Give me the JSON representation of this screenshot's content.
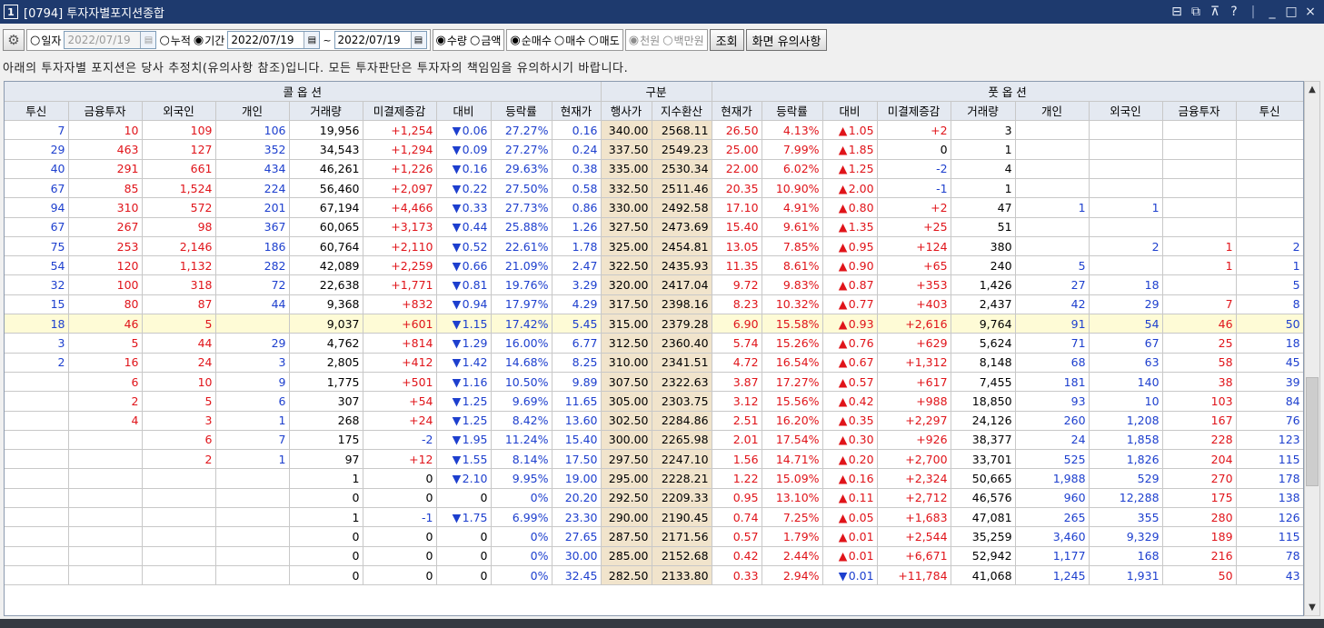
{
  "window": {
    "number": "1",
    "title": "[0794] 투자자별포지션종합",
    "controls": [
      "⊟",
      "⧉",
      "⊼",
      "?",
      "|",
      "_",
      "□",
      "×"
    ]
  },
  "toolbar": {
    "gear": "⚙",
    "date_mode": {
      "single_label": "일자",
      "single_date": "2022/07/19",
      "cumulative_label": "누적",
      "period_label": "기간",
      "from_date": "2022/07/19",
      "tilde": "~",
      "to_date": "2022/07/19",
      "selected": "기간"
    },
    "unit_mode": {
      "qty_label": "수량",
      "amount_label": "금액",
      "selected": "수량"
    },
    "trade_mode": {
      "net_label": "순매수",
      "buy_label": "매수",
      "sell_label": "매도",
      "selected": "순매수"
    },
    "currency_mode": {
      "won_label": "천원",
      "million_label": "백만원",
      "selected": "천원"
    },
    "query_button": "조회",
    "notes_button": "화면 유의사항",
    "radio_on": "◉",
    "radio_off": "○",
    "cal_icon": "▤"
  },
  "notice": "아래의 투자자별 포지션은 당사 추정치(유의사항 참조)입니다. 모든 투자판단은 투자자의 책임임을 유의하시기 바랍니다.",
  "grid": {
    "group_headers": {
      "call": "콜 옵 션",
      "center": "구분",
      "put": "풋 옵 션"
    },
    "headers": [
      "투신",
      "금융투자",
      "외국인",
      "개인",
      "거래량",
      "미결제증감",
      "대비",
      "등락률",
      "현재가",
      "행사가",
      "지수환산",
      "현재가",
      "등락률",
      "대비",
      "미결제증감",
      "거래량",
      "개인",
      "외국인",
      "금융투자",
      "투신"
    ],
    "highlight_row": 10,
    "rows": [
      [
        "7",
        "10",
        "109",
        "106",
        "19,956",
        "+1,254",
        "dn",
        "0.06",
        "27.27%",
        "0.16",
        "340.00",
        "2568.11",
        "26.50",
        "4.13%",
        "up",
        "1.05",
        "+2",
        "3",
        "",
        "",
        "",
        ""
      ],
      [
        "29",
        "463",
        "127",
        "352",
        "34,543",
        "+1,294",
        "dn",
        "0.09",
        "27.27%",
        "0.24",
        "337.50",
        "2549.23",
        "25.00",
        "7.99%",
        "up",
        "1.85",
        "0",
        "1",
        "",
        "",
        "",
        ""
      ],
      [
        "40",
        "291",
        "661",
        "434",
        "46,261",
        "+1,226",
        "dn",
        "0.16",
        "29.63%",
        "0.38",
        "335.00",
        "2530.34",
        "22.00",
        "6.02%",
        "up",
        "1.25",
        "-2",
        "4",
        "",
        "",
        "",
        ""
      ],
      [
        "67",
        "85",
        "1,524",
        "224",
        "56,460",
        "+2,097",
        "dn",
        "0.22",
        "27.50%",
        "0.58",
        "332.50",
        "2511.46",
        "20.35",
        "10.90%",
        "up",
        "2.00",
        "-1",
        "1",
        "",
        "",
        "",
        ""
      ],
      [
        "94",
        "310",
        "572",
        "201",
        "67,194",
        "+4,466",
        "dn",
        "0.33",
        "27.73%",
        "0.86",
        "330.00",
        "2492.58",
        "17.10",
        "4.91%",
        "up",
        "0.80",
        "+2",
        "47",
        "1",
        "1",
        "",
        ""
      ],
      [
        "67",
        "267",
        "98",
        "367",
        "60,065",
        "+3,173",
        "dn",
        "0.44",
        "25.88%",
        "1.26",
        "327.50",
        "2473.69",
        "15.40",
        "9.61%",
        "up",
        "1.35",
        "+25",
        "51",
        "",
        "",
        "",
        ""
      ],
      [
        "75",
        "253",
        "2,146",
        "186",
        "60,764",
        "+2,110",
        "dn",
        "0.52",
        "22.61%",
        "1.78",
        "325.00",
        "2454.81",
        "13.05",
        "7.85%",
        "up",
        "0.95",
        "+124",
        "380",
        "",
        "2",
        "1",
        "2"
      ],
      [
        "54",
        "120",
        "1,132",
        "282",
        "42,089",
        "+2,259",
        "dn",
        "0.66",
        "21.09%",
        "2.47",
        "322.50",
        "2435.93",
        "11.35",
        "8.61%",
        "up",
        "0.90",
        "+65",
        "240",
        "5",
        "",
        "1",
        "1"
      ],
      [
        "32",
        "100",
        "318",
        "72",
        "22,638",
        "+1,771",
        "dn",
        "0.81",
        "19.76%",
        "3.29",
        "320.00",
        "2417.04",
        "9.72",
        "9.83%",
        "up",
        "0.87",
        "+353",
        "1,426",
        "27",
        "18",
        "",
        "5"
      ],
      [
        "15",
        "80",
        "87",
        "44",
        "9,368",
        "+832",
        "dn",
        "0.94",
        "17.97%",
        "4.29",
        "317.50",
        "2398.16",
        "8.23",
        "10.32%",
        "up",
        "0.77",
        "+403",
        "2,437",
        "42",
        "29",
        "7",
        "8"
      ],
      [
        "18",
        "46",
        "5",
        "",
        "9,037",
        "+601",
        "dn",
        "1.15",
        "17.42%",
        "5.45",
        "315.00",
        "2379.28",
        "6.90",
        "15.58%",
        "up",
        "0.93",
        "+2,616",
        "9,764",
        "91",
        "54",
        "46",
        "50"
      ],
      [
        "3",
        "5",
        "44",
        "29",
        "4,762",
        "+814",
        "dn",
        "1.29",
        "16.00%",
        "6.77",
        "312.50",
        "2360.40",
        "5.74",
        "15.26%",
        "up",
        "0.76",
        "+629",
        "5,624",
        "71",
        "67",
        "25",
        "18"
      ],
      [
        "2",
        "16",
        "24",
        "3",
        "2,805",
        "+412",
        "dn",
        "1.42",
        "14.68%",
        "8.25",
        "310.00",
        "2341.51",
        "4.72",
        "16.54%",
        "up",
        "0.67",
        "+1,312",
        "8,148",
        "68",
        "63",
        "58",
        "45"
      ],
      [
        "",
        "6",
        "10",
        "9",
        "1,775",
        "+501",
        "dn",
        "1.16",
        "10.50%",
        "9.89",
        "307.50",
        "2322.63",
        "3.87",
        "17.27%",
        "up",
        "0.57",
        "+617",
        "7,455",
        "181",
        "140",
        "38",
        "39"
      ],
      [
        "",
        "2",
        "5",
        "6",
        "307",
        "+54",
        "dn",
        "1.25",
        "9.69%",
        "11.65",
        "305.00",
        "2303.75",
        "3.12",
        "15.56%",
        "up",
        "0.42",
        "+988",
        "18,850",
        "93",
        "10",
        "103",
        "84"
      ],
      [
        "",
        "4",
        "3",
        "1",
        "268",
        "+24",
        "dn",
        "1.25",
        "8.42%",
        "13.60",
        "302.50",
        "2284.86",
        "2.51",
        "16.20%",
        "up",
        "0.35",
        "+2,297",
        "24,126",
        "260",
        "1,208",
        "167",
        "76"
      ],
      [
        "",
        "",
        "6",
        "7",
        "175",
        "-2",
        "dn",
        "1.95",
        "11.24%",
        "15.40",
        "300.00",
        "2265.98",
        "2.01",
        "17.54%",
        "up",
        "0.30",
        "+926",
        "38,377",
        "24",
        "1,858",
        "228",
        "123"
      ],
      [
        "",
        "",
        "2",
        "1",
        "97",
        "+12",
        "dn",
        "1.55",
        "8.14%",
        "17.50",
        "297.50",
        "2247.10",
        "1.56",
        "14.71%",
        "up",
        "0.20",
        "+2,700",
        "33,701",
        "525",
        "1,826",
        "204",
        "115"
      ],
      [
        "",
        "",
        "",
        "",
        "1",
        "0",
        "dn",
        "2.10",
        "9.95%",
        "19.00",
        "295.00",
        "2228.21",
        "1.22",
        "15.09%",
        "up",
        "0.16",
        "+2,324",
        "50,665",
        "1,988",
        "529",
        "270",
        "178"
      ],
      [
        "",
        "",
        "",
        "",
        "0",
        "0",
        "",
        "0",
        "0%",
        "20.20",
        "292.50",
        "2209.33",
        "0.95",
        "13.10%",
        "up",
        "0.11",
        "+2,712",
        "46,576",
        "960",
        "12,288",
        "175",
        "138"
      ],
      [
        "",
        "",
        "",
        "",
        "1",
        "-1",
        "dn",
        "1.75",
        "6.99%",
        "23.30",
        "290.00",
        "2190.45",
        "0.74",
        "7.25%",
        "up",
        "0.05",
        "+1,683",
        "47,081",
        "265",
        "355",
        "280",
        "126"
      ],
      [
        "",
        "",
        "",
        "",
        "0",
        "0",
        "",
        "0",
        "0%",
        "27.65",
        "287.50",
        "2171.56",
        "0.57",
        "1.79%",
        "up",
        "0.01",
        "+2,544",
        "35,259",
        "3,460",
        "9,329",
        "189",
        "115"
      ],
      [
        "",
        "",
        "",
        "",
        "0",
        "0",
        "",
        "0",
        "0%",
        "30.00",
        "285.00",
        "2152.68",
        "0.42",
        "2.44%",
        "up",
        "0.01",
        "+6,671",
        "52,942",
        "1,177",
        "168",
        "216",
        "78"
      ],
      [
        "",
        "",
        "",
        "",
        "0",
        "0",
        "",
        "0",
        "0%",
        "32.45",
        "282.50",
        "2133.80",
        "0.33",
        "2.94%",
        "dn",
        "0.01",
        "+11,784",
        "41,068",
        "1,245",
        "1,931",
        "50",
        "43"
      ]
    ]
  },
  "scrollbar": {
    "up": "▲",
    "down": "▼"
  }
}
